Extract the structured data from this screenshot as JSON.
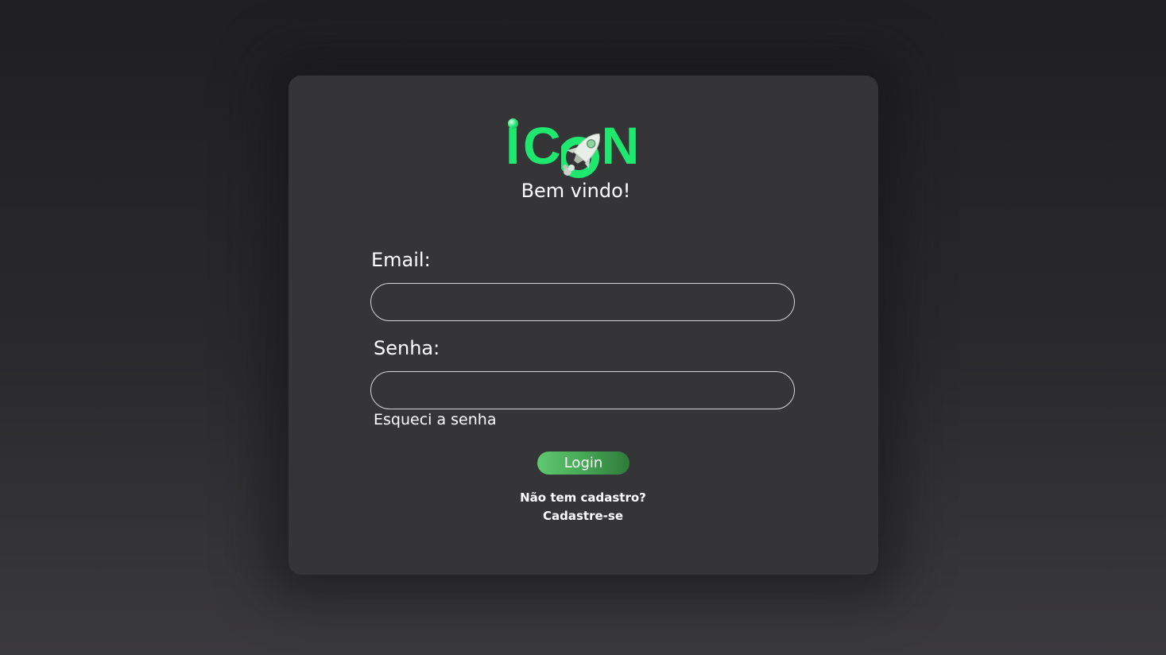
{
  "logo": {
    "text": "ICON",
    "icon": "rocket-icon",
    "brand_color": "#1ee86e"
  },
  "welcome": "Bem vindo!",
  "form": {
    "email_label": "Email:",
    "email_value": "",
    "password_label": "Senha:",
    "password_value": "",
    "forgot_password": "Esqueci a senha",
    "login_button": "Login"
  },
  "signup": {
    "question": "Não tem cadastro?",
    "link": "Cadastre-se"
  },
  "colors": {
    "background": "#2a2a2d",
    "card": "#353538",
    "button_gradient_start": "#5fc870",
    "button_gradient_end": "#2f7a3a"
  }
}
